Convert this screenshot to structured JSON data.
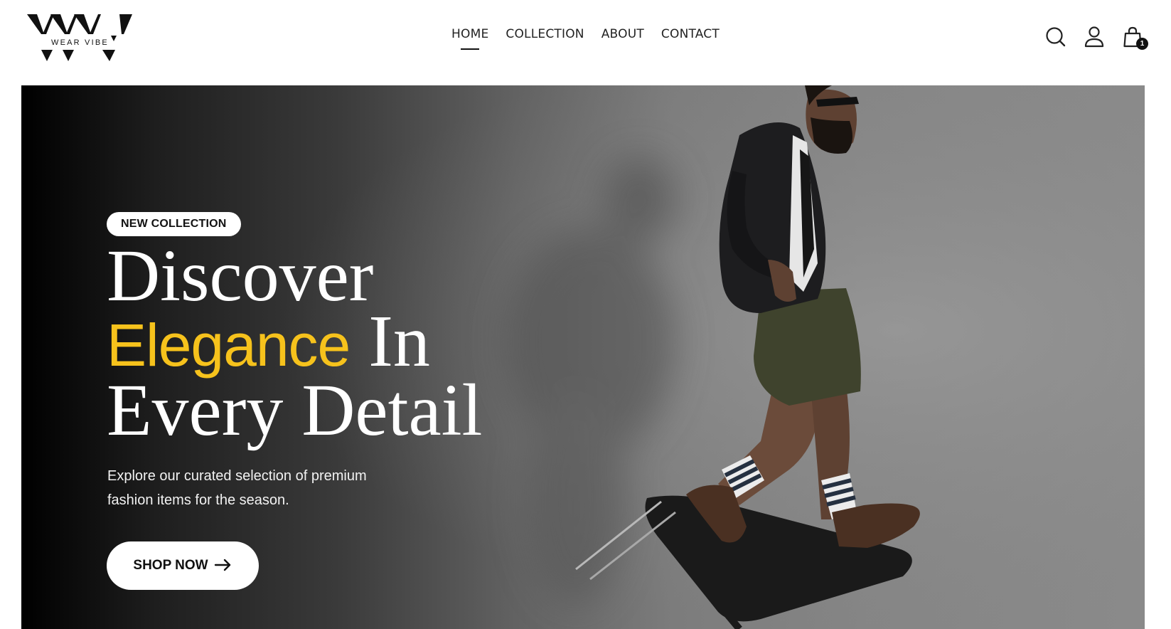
{
  "brand": {
    "logo_text": "WEAR VIBE"
  },
  "nav": {
    "items": [
      {
        "label": "HOME",
        "active": true
      },
      {
        "label": "COLLECTION",
        "active": false
      },
      {
        "label": "ABOUT",
        "active": false
      },
      {
        "label": "CONTACT",
        "active": false
      }
    ]
  },
  "header_icons": {
    "search": "search-icon",
    "account": "user-icon",
    "cart": "shopping-bag-icon",
    "cart_count": "1"
  },
  "hero": {
    "badge": "NEW COLLECTION",
    "headline_1": "Discover",
    "headline_2_accent": "Elegance",
    "headline_2_rest": " In",
    "headline_3": "Every Detail",
    "subtitle": "Explore our curated selection of premium fashion items for the season.",
    "cta_label": "SHOP NOW",
    "accent_color": "#f6c21c"
  }
}
